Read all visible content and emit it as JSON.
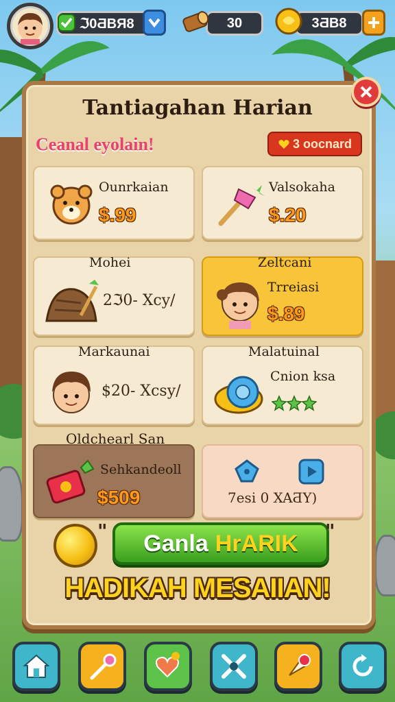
{
  "hud": {
    "currency1_value": "ℑ0ƋBЯ8",
    "currency2_value": "30",
    "currency3_value": "3ƋB8"
  },
  "panel": {
    "title": "Tantiagahan Harian",
    "subtitle": "Ceanal eyolain!",
    "badge": "3 oocnard"
  },
  "cards": [
    {
      "name": "Ounrkaian",
      "price": "$.99"
    },
    {
      "name": "Valsokaha",
      "price": "$.20"
    },
    {
      "head": "Mohei",
      "note": "2ℑ0- Xcy/"
    },
    {
      "head": "Zeltcani",
      "name": "Trreiasi",
      "price": "$.89"
    },
    {
      "head": "Markaunai",
      "note": "$20- Xcsy/"
    },
    {
      "head": "Malatuinal",
      "name": "Cnion ksa"
    },
    {
      "head": "Oldchearl San",
      "name": "Sehkandeoll",
      "price": "$509"
    },
    {
      "note": "7esi  0  XAƋY)"
    }
  ],
  "claim": {
    "label_a": "Ganla",
    "label_b": "HrARIK",
    "banner": "HADIKAH MESAIIAN!"
  },
  "colors": {
    "panel_bg": "#e9d3a8",
    "claim_green": "#3a9f1f",
    "gold": "#f8c43a",
    "close_red": "#e23b3b"
  },
  "icons": [
    "home-icon",
    "magic-wand-icon",
    "heart-balloon-icon",
    "tools-icon",
    "ice-cream-icon",
    "refresh-icon"
  ]
}
